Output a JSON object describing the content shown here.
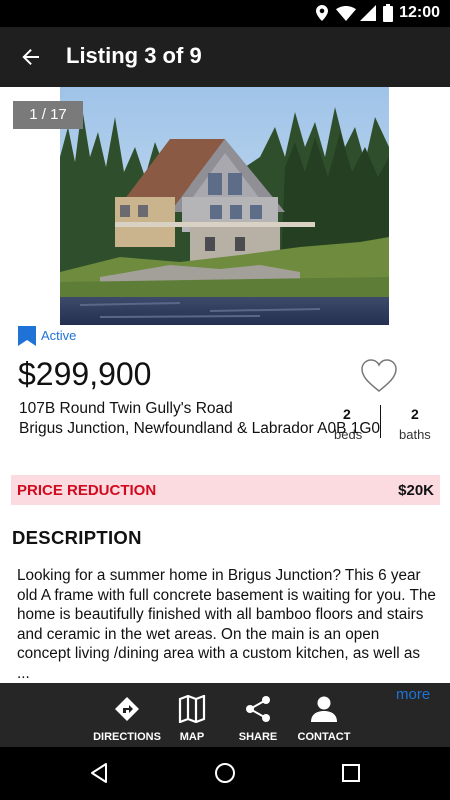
{
  "status_bar": {
    "time": "12:00",
    "icons": [
      "location-icon",
      "wifi-icon",
      "signal-icon",
      "battery-icon"
    ]
  },
  "app_bar": {
    "title": "Listing 3 of 9",
    "back_icon": "arrow-left-icon"
  },
  "photo": {
    "counter": "1 / 17",
    "description_icon": "house-photo"
  },
  "listing": {
    "status": "Active",
    "price": "$299,900",
    "address_line1": "107B Round Twin Gully's Road",
    "address_line2": "Brigus Junction, Newfoundland & Labrador A0B 1G0",
    "beds_value": "2",
    "beds_label": "beds",
    "baths_value": "2",
    "baths_label": "baths",
    "favorite_icon": "heart-outline-icon"
  },
  "price_reduction": {
    "label": "PRICE REDUCTION",
    "amount": "$20K",
    "bg_color": "#fbdbe0",
    "label_color": "#d10a1f"
  },
  "description": {
    "heading": "DESCRIPTION",
    "text": "Looking for a summer home in Brigus Junction? This 6 year old A frame with full concrete basement is waiting for you. The home is beautifully finished with all bamboo floors and stairs and ceramic in the wet areas. On the main is an open concept living /dining area with a custom kitchen, as well as ...",
    "more_link": "more"
  },
  "actions": [
    {
      "label": "DIRECTIONS",
      "icon": "directions-icon"
    },
    {
      "label": "MAP",
      "icon": "map-icon"
    },
    {
      "label": "SHARE",
      "icon": "share-icon"
    },
    {
      "label": "CONTACT",
      "icon": "contact-icon"
    }
  ],
  "nav_bar": {
    "buttons": [
      "back-triangle-icon",
      "home-circle-icon",
      "recents-square-icon"
    ]
  },
  "colors": {
    "accent": "#1f73d6",
    "app_bar": "#1f1f1f",
    "status_bar": "#000000"
  }
}
